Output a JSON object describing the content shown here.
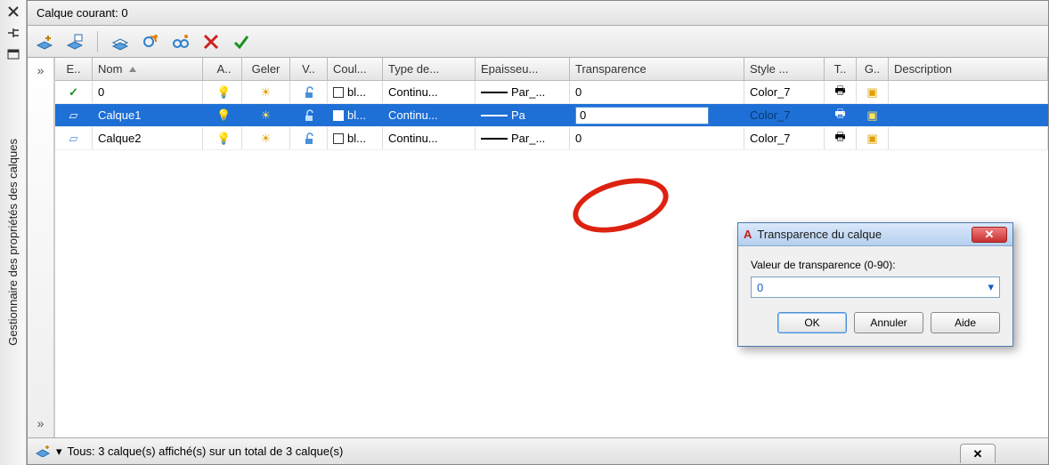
{
  "left_rail": {
    "title": "Gestionnaire des propriétés des calques"
  },
  "titlebar": {
    "text": "Calque courant: 0"
  },
  "columns": {
    "status": "E..",
    "nom": "Nom",
    "a": "A..",
    "geler": "Geler",
    "v": "V..",
    "coul": "Coul...",
    "type": "Type de...",
    "epais": "Epaisseu...",
    "trans": "Transparence",
    "style": "Style ...",
    "t": "T..",
    "g": "G..",
    "desc": "Description"
  },
  "rows": [
    {
      "current": true,
      "selected": false,
      "nom": "0",
      "coul_label": "bl...",
      "type": "Continu...",
      "epais": "Par_...",
      "trans": "0",
      "style": "Color_7"
    },
    {
      "current": false,
      "selected": true,
      "nom": "Calque1",
      "coul_label": "bl...",
      "type": "Continu...",
      "epais": "Pa",
      "trans_edit": "0",
      "style": "Color_7"
    },
    {
      "current": false,
      "selected": false,
      "nom": "Calque2",
      "coul_label": "bl...",
      "type": "Continu...",
      "epais": "Par_...",
      "trans": "0",
      "style": "Color_7"
    }
  ],
  "statusbar": {
    "text": "Tous: 3 calque(s) affiché(s) sur un total de 3 calque(s)"
  },
  "dialog": {
    "title": "Transparence du calque",
    "label": "Valeur de transparence (0-90):",
    "value": "0",
    "ok": "OK",
    "cancel": "Annuler",
    "help": "Aide"
  },
  "glyphs": {
    "check": "✓",
    "bulb": "💡",
    "sun": "☀",
    "lock": "🔓",
    "printer": "🖶",
    "refresh": "🔄",
    "chev": "»",
    "x": "✕",
    "tri": "▾",
    "status_layer": "▱"
  }
}
